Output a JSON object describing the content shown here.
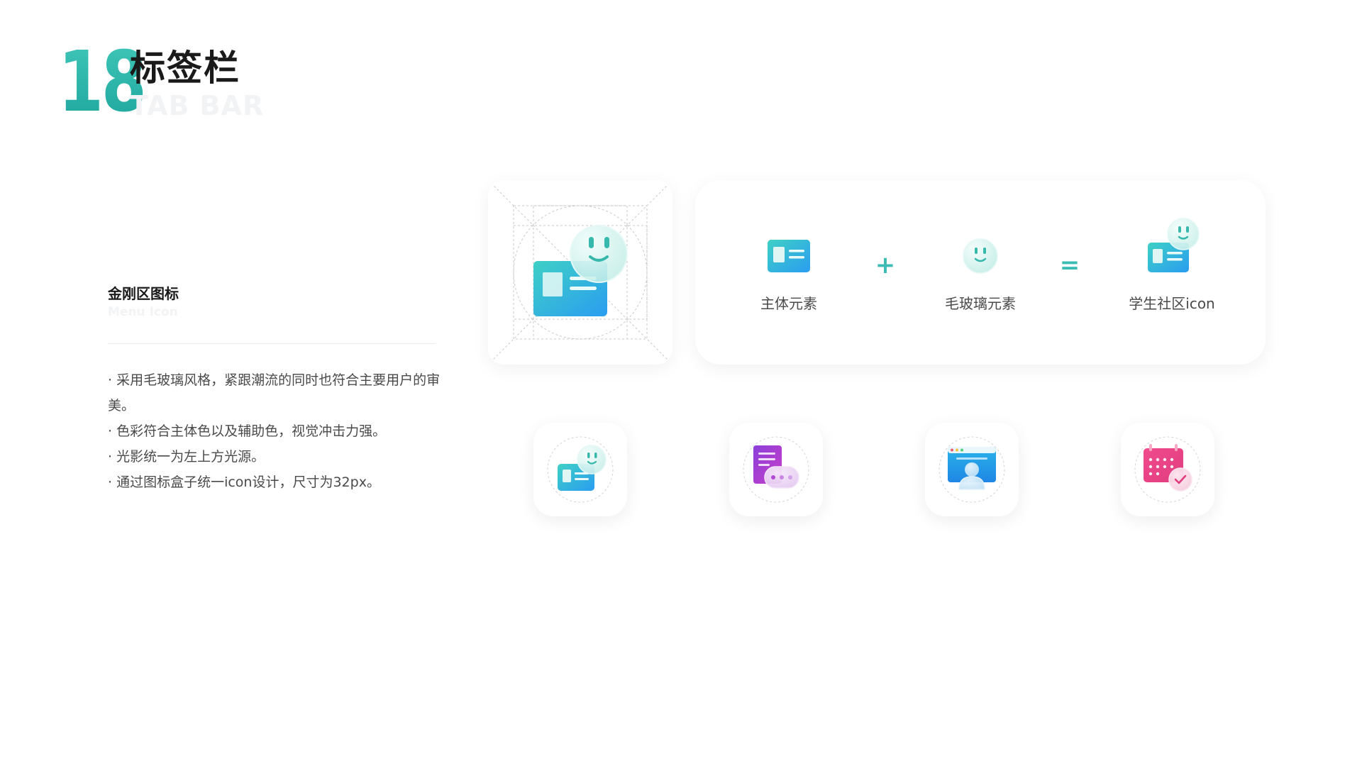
{
  "header": {
    "number": "18",
    "title": "标签栏",
    "subtitle": "TAB BAR"
  },
  "section": {
    "title": "金刚区图标",
    "subtitle": "Menu Icon",
    "bullets": [
      "· 采用毛玻璃风格，紧跟潮流的同时也符合主要用户的审美。",
      "· 色彩符合主体色以及辅助色，视觉冲击力强。",
      "· 光影统一为左上方光源。",
      "· 通过图标盒子统一icon设计，尺寸为32px。"
    ]
  },
  "formula": {
    "items": [
      {
        "label": "主体元素",
        "icon": "id-card-icon"
      },
      {
        "label": "毛玻璃元素",
        "icon": "smiley-glass-icon"
      },
      {
        "label": "学生社区icon",
        "icon": "student-community-icon"
      }
    ],
    "plus": "+",
    "equals": "="
  },
  "tiles": [
    {
      "icon": "student-community-icon"
    },
    {
      "icon": "document-chat-icon"
    },
    {
      "icon": "monitor-user-icon"
    },
    {
      "icon": "calendar-check-icon"
    }
  ],
  "colors": {
    "accent": "#3cbcb4",
    "teal_gradient_top": "#3fc6b8",
    "teal_gradient_bottom": "#1fa69e",
    "blue_card_start": "#3fd0c6",
    "blue_card_end": "#2a9df0",
    "purple": "#9b3fd6",
    "pink": "#ec4f95",
    "text_dark": "#1a1a1a",
    "text_body": "#4a4a4a"
  }
}
